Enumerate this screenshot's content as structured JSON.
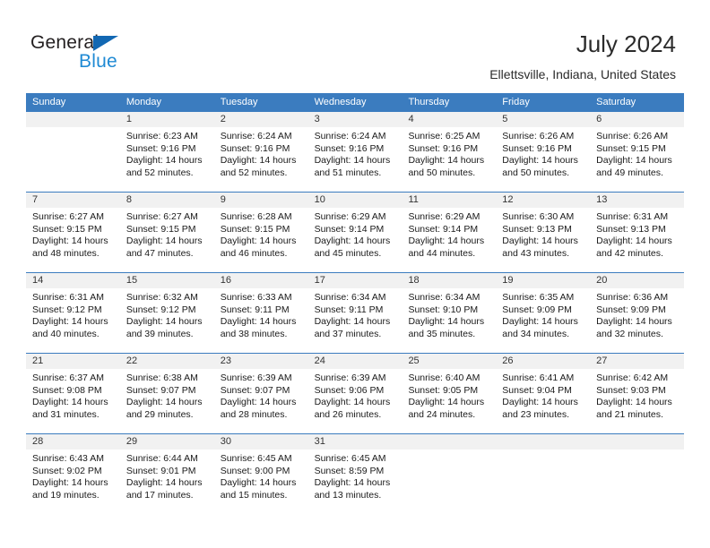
{
  "brand": {
    "word_one": "General",
    "word_two": "Blue",
    "triangle_color": "#1268b3",
    "blue_text_color": "#1f8ad4"
  },
  "header": {
    "title": "July 2024",
    "location": "Ellettsville, Indiana, United States",
    "header_bg": "#3b7cbf",
    "day_band_bg": "#f1f1f1"
  },
  "weekdays": [
    "Sunday",
    "Monday",
    "Tuesday",
    "Wednesday",
    "Thursday",
    "Friday",
    "Saturday"
  ],
  "weeks": [
    {
      "days": [
        {
          "number": "",
          "empty": true,
          "sunrise": "",
          "sunset": "",
          "daylight_line1": "",
          "daylight_line2": ""
        },
        {
          "number": "1",
          "empty": false,
          "sunrise": "Sunrise: 6:23 AM",
          "sunset": "Sunset: 9:16 PM",
          "daylight_line1": "Daylight: 14 hours",
          "daylight_line2": "and 52 minutes."
        },
        {
          "number": "2",
          "empty": false,
          "sunrise": "Sunrise: 6:24 AM",
          "sunset": "Sunset: 9:16 PM",
          "daylight_line1": "Daylight: 14 hours",
          "daylight_line2": "and 52 minutes."
        },
        {
          "number": "3",
          "empty": false,
          "sunrise": "Sunrise: 6:24 AM",
          "sunset": "Sunset: 9:16 PM",
          "daylight_line1": "Daylight: 14 hours",
          "daylight_line2": "and 51 minutes."
        },
        {
          "number": "4",
          "empty": false,
          "sunrise": "Sunrise: 6:25 AM",
          "sunset": "Sunset: 9:16 PM",
          "daylight_line1": "Daylight: 14 hours",
          "daylight_line2": "and 50 minutes."
        },
        {
          "number": "5",
          "empty": false,
          "sunrise": "Sunrise: 6:26 AM",
          "sunset": "Sunset: 9:16 PM",
          "daylight_line1": "Daylight: 14 hours",
          "daylight_line2": "and 50 minutes."
        },
        {
          "number": "6",
          "empty": false,
          "sunrise": "Sunrise: 6:26 AM",
          "sunset": "Sunset: 9:15 PM",
          "daylight_line1": "Daylight: 14 hours",
          "daylight_line2": "and 49 minutes."
        }
      ]
    },
    {
      "days": [
        {
          "number": "7",
          "empty": false,
          "sunrise": "Sunrise: 6:27 AM",
          "sunset": "Sunset: 9:15 PM",
          "daylight_line1": "Daylight: 14 hours",
          "daylight_line2": "and 48 minutes."
        },
        {
          "number": "8",
          "empty": false,
          "sunrise": "Sunrise: 6:27 AM",
          "sunset": "Sunset: 9:15 PM",
          "daylight_line1": "Daylight: 14 hours",
          "daylight_line2": "and 47 minutes."
        },
        {
          "number": "9",
          "empty": false,
          "sunrise": "Sunrise: 6:28 AM",
          "sunset": "Sunset: 9:15 PM",
          "daylight_line1": "Daylight: 14 hours",
          "daylight_line2": "and 46 minutes."
        },
        {
          "number": "10",
          "empty": false,
          "sunrise": "Sunrise: 6:29 AM",
          "sunset": "Sunset: 9:14 PM",
          "daylight_line1": "Daylight: 14 hours",
          "daylight_line2": "and 45 minutes."
        },
        {
          "number": "11",
          "empty": false,
          "sunrise": "Sunrise: 6:29 AM",
          "sunset": "Sunset: 9:14 PM",
          "daylight_line1": "Daylight: 14 hours",
          "daylight_line2": "and 44 minutes."
        },
        {
          "number": "12",
          "empty": false,
          "sunrise": "Sunrise: 6:30 AM",
          "sunset": "Sunset: 9:13 PM",
          "daylight_line1": "Daylight: 14 hours",
          "daylight_line2": "and 43 minutes."
        },
        {
          "number": "13",
          "empty": false,
          "sunrise": "Sunrise: 6:31 AM",
          "sunset": "Sunset: 9:13 PM",
          "daylight_line1": "Daylight: 14 hours",
          "daylight_line2": "and 42 minutes."
        }
      ]
    },
    {
      "days": [
        {
          "number": "14",
          "empty": false,
          "sunrise": "Sunrise: 6:31 AM",
          "sunset": "Sunset: 9:12 PM",
          "daylight_line1": "Daylight: 14 hours",
          "daylight_line2": "and 40 minutes."
        },
        {
          "number": "15",
          "empty": false,
          "sunrise": "Sunrise: 6:32 AM",
          "sunset": "Sunset: 9:12 PM",
          "daylight_line1": "Daylight: 14 hours",
          "daylight_line2": "and 39 minutes."
        },
        {
          "number": "16",
          "empty": false,
          "sunrise": "Sunrise: 6:33 AM",
          "sunset": "Sunset: 9:11 PM",
          "daylight_line1": "Daylight: 14 hours",
          "daylight_line2": "and 38 minutes."
        },
        {
          "number": "17",
          "empty": false,
          "sunrise": "Sunrise: 6:34 AM",
          "sunset": "Sunset: 9:11 PM",
          "daylight_line1": "Daylight: 14 hours",
          "daylight_line2": "and 37 minutes."
        },
        {
          "number": "18",
          "empty": false,
          "sunrise": "Sunrise: 6:34 AM",
          "sunset": "Sunset: 9:10 PM",
          "daylight_line1": "Daylight: 14 hours",
          "daylight_line2": "and 35 minutes."
        },
        {
          "number": "19",
          "empty": false,
          "sunrise": "Sunrise: 6:35 AM",
          "sunset": "Sunset: 9:09 PM",
          "daylight_line1": "Daylight: 14 hours",
          "daylight_line2": "and 34 minutes."
        },
        {
          "number": "20",
          "empty": false,
          "sunrise": "Sunrise: 6:36 AM",
          "sunset": "Sunset: 9:09 PM",
          "daylight_line1": "Daylight: 14 hours",
          "daylight_line2": "and 32 minutes."
        }
      ]
    },
    {
      "days": [
        {
          "number": "21",
          "empty": false,
          "sunrise": "Sunrise: 6:37 AM",
          "sunset": "Sunset: 9:08 PM",
          "daylight_line1": "Daylight: 14 hours",
          "daylight_line2": "and 31 minutes."
        },
        {
          "number": "22",
          "empty": false,
          "sunrise": "Sunrise: 6:38 AM",
          "sunset": "Sunset: 9:07 PM",
          "daylight_line1": "Daylight: 14 hours",
          "daylight_line2": "and 29 minutes."
        },
        {
          "number": "23",
          "empty": false,
          "sunrise": "Sunrise: 6:39 AM",
          "sunset": "Sunset: 9:07 PM",
          "daylight_line1": "Daylight: 14 hours",
          "daylight_line2": "and 28 minutes."
        },
        {
          "number": "24",
          "empty": false,
          "sunrise": "Sunrise: 6:39 AM",
          "sunset": "Sunset: 9:06 PM",
          "daylight_line1": "Daylight: 14 hours",
          "daylight_line2": "and 26 minutes."
        },
        {
          "number": "25",
          "empty": false,
          "sunrise": "Sunrise: 6:40 AM",
          "sunset": "Sunset: 9:05 PM",
          "daylight_line1": "Daylight: 14 hours",
          "daylight_line2": "and 24 minutes."
        },
        {
          "number": "26",
          "empty": false,
          "sunrise": "Sunrise: 6:41 AM",
          "sunset": "Sunset: 9:04 PM",
          "daylight_line1": "Daylight: 14 hours",
          "daylight_line2": "and 23 minutes."
        },
        {
          "number": "27",
          "empty": false,
          "sunrise": "Sunrise: 6:42 AM",
          "sunset": "Sunset: 9:03 PM",
          "daylight_line1": "Daylight: 14 hours",
          "daylight_line2": "and 21 minutes."
        }
      ]
    },
    {
      "days": [
        {
          "number": "28",
          "empty": false,
          "sunrise": "Sunrise: 6:43 AM",
          "sunset": "Sunset: 9:02 PM",
          "daylight_line1": "Daylight: 14 hours",
          "daylight_line2": "and 19 minutes."
        },
        {
          "number": "29",
          "empty": false,
          "sunrise": "Sunrise: 6:44 AM",
          "sunset": "Sunset: 9:01 PM",
          "daylight_line1": "Daylight: 14 hours",
          "daylight_line2": "and 17 minutes."
        },
        {
          "number": "30",
          "empty": false,
          "sunrise": "Sunrise: 6:45 AM",
          "sunset": "Sunset: 9:00 PM",
          "daylight_line1": "Daylight: 14 hours",
          "daylight_line2": "and 15 minutes."
        },
        {
          "number": "31",
          "empty": false,
          "sunrise": "Sunrise: 6:45 AM",
          "sunset": "Sunset: 8:59 PM",
          "daylight_line1": "Daylight: 14 hours",
          "daylight_line2": "and 13 minutes."
        },
        {
          "number": "",
          "empty": true,
          "sunrise": "",
          "sunset": "",
          "daylight_line1": "",
          "daylight_line2": ""
        },
        {
          "number": "",
          "empty": true,
          "sunrise": "",
          "sunset": "",
          "daylight_line1": "",
          "daylight_line2": ""
        },
        {
          "number": "",
          "empty": true,
          "sunrise": "",
          "sunset": "",
          "daylight_line1": "",
          "daylight_line2": ""
        }
      ]
    }
  ]
}
